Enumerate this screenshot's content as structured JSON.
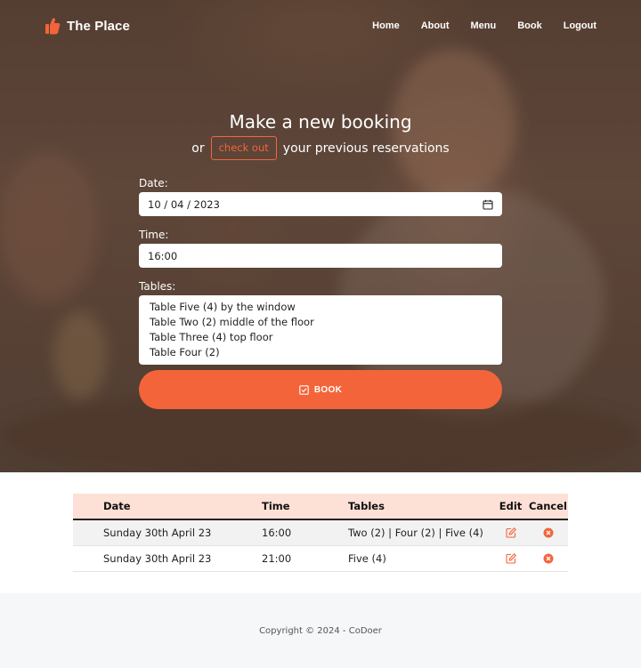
{
  "brand": {
    "name": "The Place",
    "icon": "thumbs-up-icon",
    "accent": "#f4643a"
  },
  "nav": {
    "items": [
      "Home",
      "About",
      "Menu",
      "Book",
      "Logout"
    ]
  },
  "hero": {
    "title": "Make a new booking",
    "sub_before": "or",
    "sub_button": "check out",
    "sub_after": "your previous reservations"
  },
  "form": {
    "date_label": "Date:",
    "date_value": "10 / 04 / 2023",
    "time_label": "Time:",
    "time_value": "16:00",
    "tables_label": "Tables:",
    "tables_options": [
      "Table Five (4) by the window",
      "Table Two (2) middle of the floor",
      "Table Three (4) top floor",
      "Table Four (2)"
    ],
    "book_label": "BOOK"
  },
  "reservations": {
    "headers": [
      "Date",
      "Time",
      "Tables",
      "Edit",
      "Cancel"
    ],
    "rows": [
      {
        "date": "Sunday 30th April 23",
        "time": "16:00",
        "tables": "Two (2) | Four (2) | Five (4)"
      },
      {
        "date": "Sunday 30th April 23",
        "time": "21:00",
        "tables": "Five (4)"
      }
    ],
    "header_bg": "#fde0d6"
  },
  "footer": {
    "text": "Copyright © 2024 - CoDoer"
  }
}
